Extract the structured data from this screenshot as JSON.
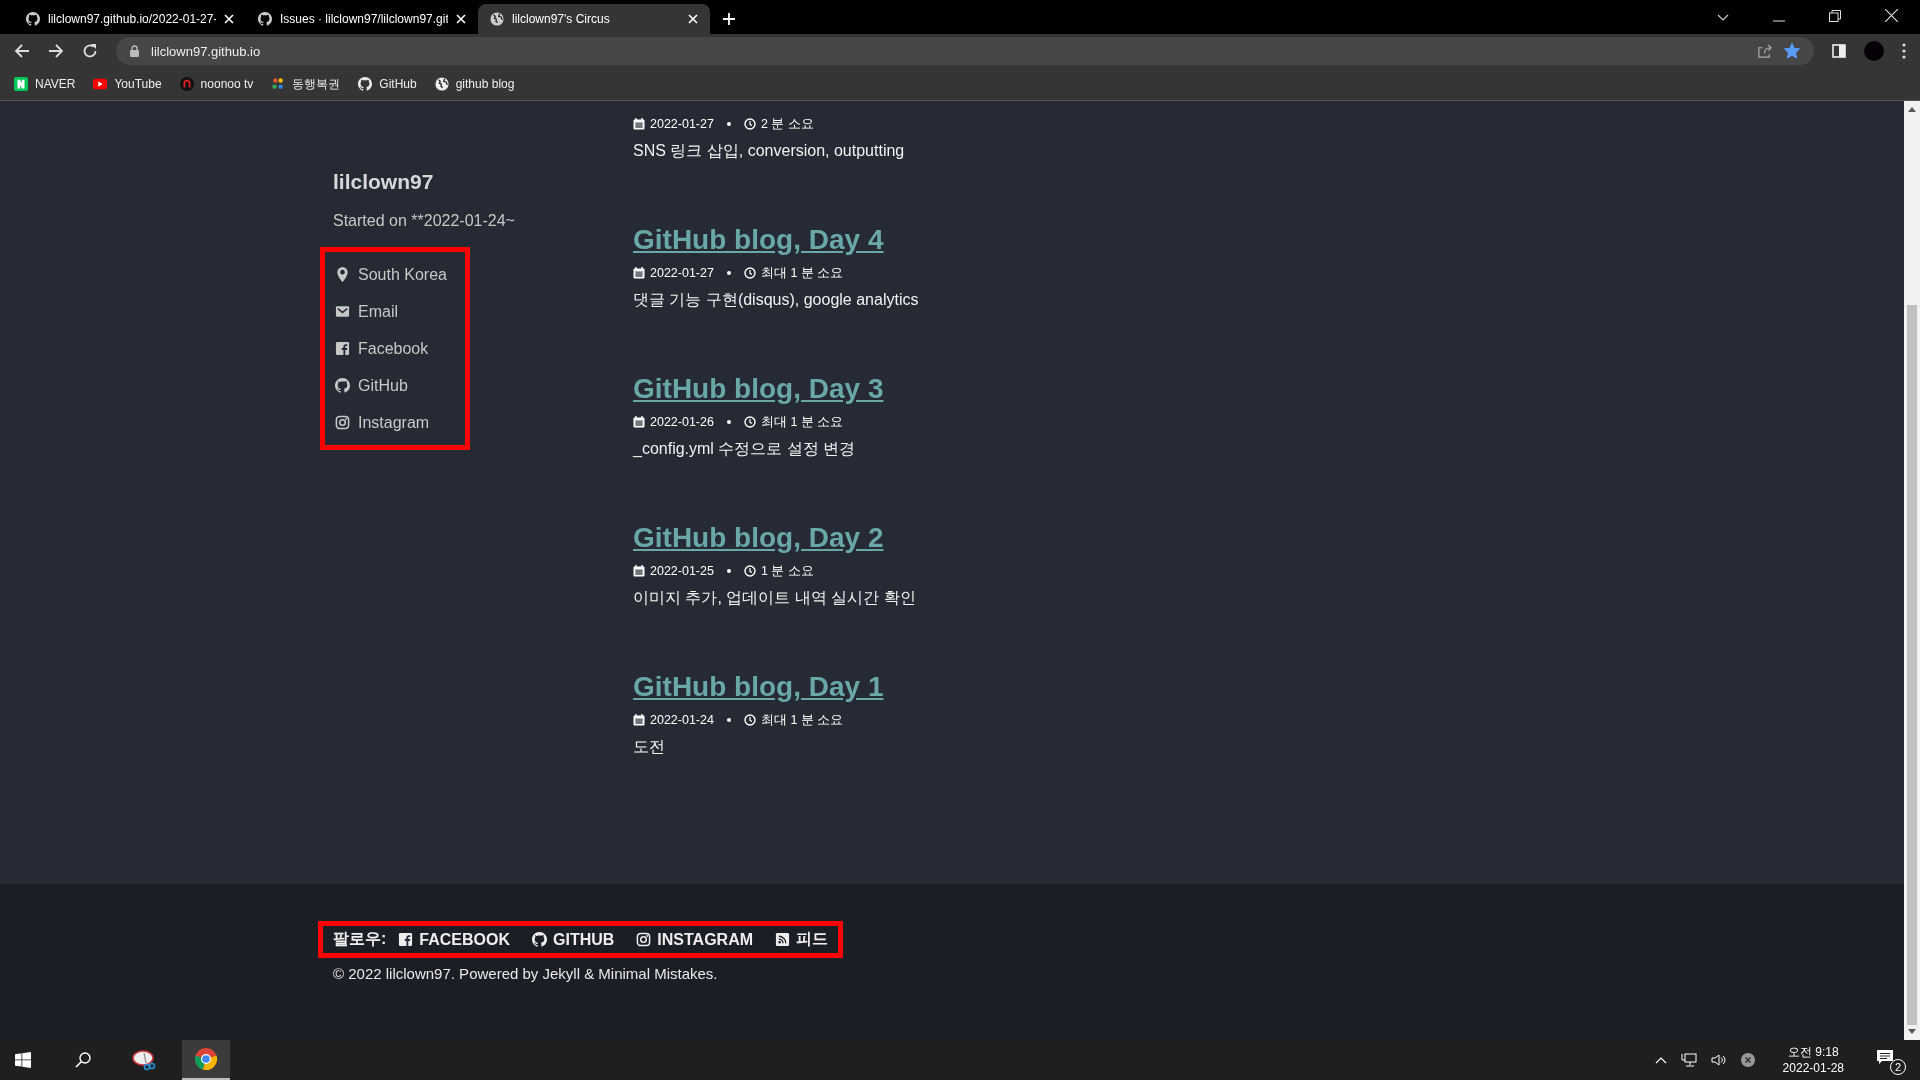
{
  "browser": {
    "tabs": [
      {
        "title": "lilclown97.github.io/2022-01-27-",
        "kind": "github",
        "selected": false
      },
      {
        "title": "Issues · lilclown97/lilclown97.git",
        "kind": "github",
        "selected": false
      },
      {
        "title": "lilclown97's Circus",
        "kind": "globe",
        "selected": true
      }
    ],
    "address": "lilclown97.github.io",
    "bookmarked": true,
    "bookmarks": [
      {
        "label": "NAVER",
        "kind": "naver"
      },
      {
        "label": "YouTube",
        "kind": "youtube"
      },
      {
        "label": "noonoo tv",
        "kind": "arch"
      },
      {
        "label": "동행복권",
        "kind": "pinwheel"
      },
      {
        "label": "GitHub",
        "kind": "github"
      },
      {
        "label": "github blog",
        "kind": "globe"
      }
    ]
  },
  "sidebar": {
    "name": "lilclown97",
    "bio": "Started on **2022-01-24~",
    "highlighted": true,
    "links": [
      {
        "label": "South Korea",
        "kind": "pin"
      },
      {
        "label": "Email",
        "kind": "mail"
      },
      {
        "label": "Facebook",
        "kind": "facebook"
      },
      {
        "label": "GitHub",
        "kind": "github"
      },
      {
        "label": "Instagram",
        "kind": "instagram"
      }
    ]
  },
  "posts": [
    {
      "date": "2022-01-27",
      "read_time": "2 분 소요",
      "excerpt": "SNS 링크 삽입, conversion, outputting"
    },
    {
      "title": "GitHub blog, Day 4",
      "date": "2022-01-27",
      "read_time": "최대 1 분 소요",
      "excerpt": "댓글 기능 구현(disqus), google analytics"
    },
    {
      "title": "GitHub blog, Day 3",
      "date": "2022-01-26",
      "read_time": "최대 1 분 소요",
      "excerpt": "_config.yml 수정으로 설정 변경"
    },
    {
      "title": "GitHub blog, Day 2",
      "date": "2022-01-25",
      "read_time": "1 분 소요",
      "excerpt": "이미지 추가, 업데이트 내역 실시간 확인"
    },
    {
      "title": "GitHub blog, Day 1",
      "date": "2022-01-24",
      "read_time": "최대 1 분 소요",
      "excerpt": "도전"
    }
  ],
  "footer": {
    "follow_label": "팔로우:",
    "highlighted": true,
    "links": [
      {
        "label": "FACEBOOK",
        "kind": "facebook"
      },
      {
        "label": "GITHUB",
        "kind": "github"
      },
      {
        "label": "INSTAGRAM",
        "kind": "instagram"
      },
      {
        "label": "피드",
        "kind": "rss"
      }
    ],
    "copyright": "© 2022 lilclown97. Powered by Jekyll & Minimal Mistakes."
  },
  "taskbar": {
    "apps": [
      {
        "kind": "snip",
        "selected": false
      },
      {
        "kind": "chrome",
        "selected": true
      }
    ],
    "time": "오전 9:18",
    "date": "2022-01-28",
    "notifications": "2"
  }
}
